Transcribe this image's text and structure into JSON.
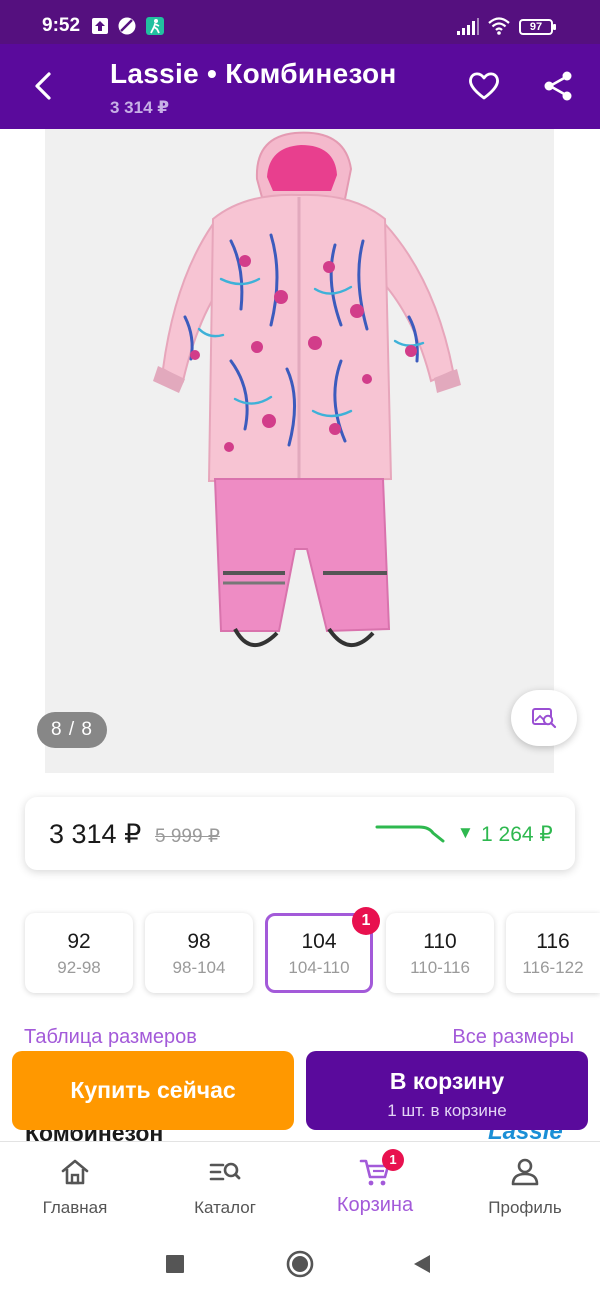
{
  "status_bar": {
    "time": "9:52",
    "battery": "97",
    "icons": [
      "upload-icon",
      "data-saver-icon",
      "activity-icon",
      "signal-icon",
      "wifi-icon",
      "battery-icon"
    ]
  },
  "header": {
    "title": "Lassie • Комбинезон",
    "price": "3 314 ₽"
  },
  "gallery": {
    "counter": "8 / 8"
  },
  "price_card": {
    "current": "3 314 ₽",
    "old": "5 999 ₽",
    "drop_arrow": "▼",
    "drop": "1 264 ₽"
  },
  "sizes": {
    "items": [
      {
        "size": "92",
        "range": "92-98"
      },
      {
        "size": "98",
        "range": "98-104"
      },
      {
        "size": "104",
        "range": "104-110"
      },
      {
        "size": "110",
        "range": "110-116"
      },
      {
        "size": "116",
        "range": "116-122"
      }
    ],
    "selected_badge": "1",
    "table_link": "Таблица размеров",
    "all_link": "Все размеры"
  },
  "peek": {
    "title": "Комбинезон",
    "brand": "Lassie"
  },
  "actions": {
    "buy_now": "Купить сейчас",
    "add_to_cart": "В корзину",
    "in_cart": "1 шт. в корзине"
  },
  "bottom_nav": {
    "items": [
      {
        "label": "Главная",
        "icon": "home-icon"
      },
      {
        "label": "Каталог",
        "icon": "catalog-search-icon"
      },
      {
        "label": "Корзина",
        "icon": "cart-icon"
      },
      {
        "label": "Профиль",
        "icon": "profile-icon"
      }
    ],
    "cart_badge": "1",
    "active": "Корзина"
  },
  "colors": {
    "primary": "#5a0a9c",
    "accent": "#a35ad9",
    "orange": "#ff9800",
    "green": "#2eb84f",
    "badge": "#e8114f"
  }
}
